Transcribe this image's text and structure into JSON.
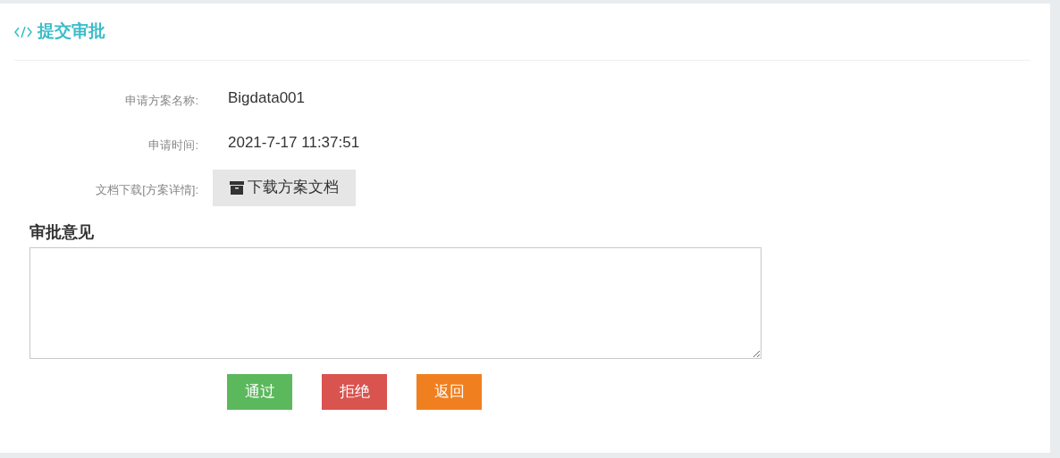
{
  "panel": {
    "title": "提交审批"
  },
  "fields": [
    {
      "kind": "text",
      "label": "申请方案名称:",
      "value": "Bigdata001"
    },
    {
      "kind": "text",
      "label": "申请时间:",
      "value": "2021-7-17 11:37:51"
    },
    {
      "kind": "download",
      "label": "文档下载[方案详情]:",
      "value": "下载方案文档"
    }
  ],
  "opinion": {
    "label": "审批意见"
  },
  "buttons": [
    {
      "label": "通过",
      "color": "#5cb85c"
    },
    {
      "label": "拒绝",
      "color": "#d9534f"
    },
    {
      "label": "返回",
      "color": "#f0801f"
    }
  ]
}
